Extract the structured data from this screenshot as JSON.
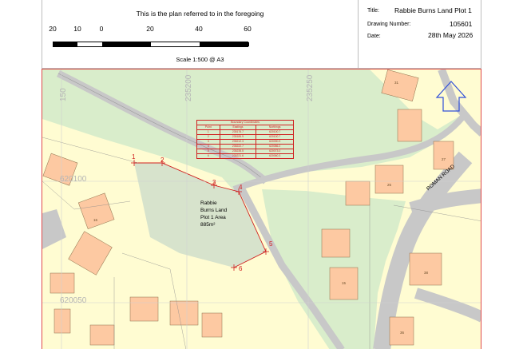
{
  "header": {
    "plan_caption": "This is the plan referred to in the foregoing",
    "scale_labels": [
      "20",
      "10",
      "0",
      "20",
      "40",
      "60"
    ],
    "scale_text": "Scale 1:500 @ A3",
    "title_label": "Title:",
    "title_value": "Rabbie Burns Land Plot 1",
    "drawing_number_label": "Drawing Number:",
    "drawing_number_value": "105601",
    "date_label": "Date:",
    "date_value": "28th May 2026"
  },
  "map": {
    "grid_labels": {
      "east_1": "235200",
      "east_2": "235250",
      "east_left": "150",
      "north_1": "620100",
      "north_2": "620050"
    },
    "boundary_table": {
      "title": "Boundary Coordinates",
      "headers": [
        "Point",
        "Eastings",
        "Northings"
      ],
      "rows": [
        [
          "1",
          "235176.7",
          "620100.7"
        ],
        [
          "2",
          "235185.9",
          "620100.7"
        ],
        [
          "3",
          "235212.3",
          "620090.9"
        ],
        [
          "4",
          "235222.7",
          "620086.2"
        ],
        [
          "5",
          "235235.5",
          "620073.0"
        ],
        [
          "6",
          "235221.6",
          "620060.3"
        ]
      ]
    },
    "points": [
      "1",
      "2",
      "3",
      "4",
      "5",
      "6"
    ],
    "area_label": {
      "line1": "Rabbie",
      "line2": "Burns Land",
      "line3": "Plot 1 Area",
      "line4": "885m²"
    },
    "road_name": "ROMAN ROAD",
    "house_numbers": [
      "31",
      "27",
      "25",
      "15",
      "38",
      "36",
      "16"
    ],
    "north_arrow": "north-arrow-icon"
  },
  "colors": {
    "greenspace": "#d9edcb",
    "land": "#fffcd2",
    "building": "#fdc9a2",
    "road": "#c8c8c8",
    "plot": "#d7e3cc",
    "boundary": "#d02020",
    "north_arrow": "#3050d8"
  }
}
